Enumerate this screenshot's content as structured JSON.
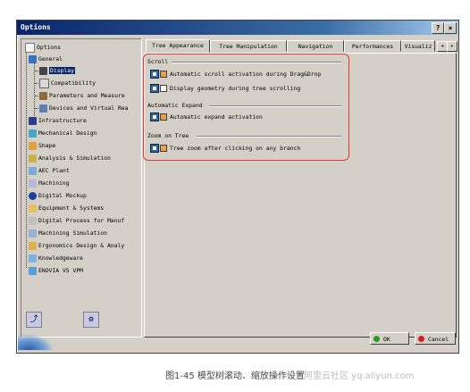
{
  "window": {
    "title": "Options",
    "help_btn": "?",
    "close_btn": "×"
  },
  "tree": {
    "root": "Options",
    "items": [
      {
        "label": "General"
      },
      {
        "label": "Display",
        "selected": true
      },
      {
        "label": "Compatibility"
      },
      {
        "label": "Parameters and Measure"
      },
      {
        "label": "Devices and Virtual Rea"
      },
      {
        "label": "Infrastructure"
      },
      {
        "label": "Mechanical Design"
      },
      {
        "label": "Shape"
      },
      {
        "label": "Analysis & Simulation"
      },
      {
        "label": "AEC Plant"
      },
      {
        "label": "Machining"
      },
      {
        "label": "Digital Mockup"
      },
      {
        "label": "Equipment & Systems"
      },
      {
        "label": "Digital Process for Manuf"
      },
      {
        "label": "Machining Simulation"
      },
      {
        "label": "Ergonomics Design & Analy"
      },
      {
        "label": "Knowledgeware"
      },
      {
        "label": "ENOVIA V5 VPM"
      }
    ]
  },
  "tabs": [
    "Tree Appearance",
    "Tree Manipulation",
    "Navigation",
    "Performances",
    "Visualiz"
  ],
  "groups": {
    "scroll": {
      "title": "Scroll",
      "options": [
        {
          "label": "Automatic scroll activation during Drag&Drop",
          "checked": true
        },
        {
          "label": "Display geometry during tree scrolling",
          "checked": false
        }
      ]
    },
    "expand": {
      "title": "Automatic Expand",
      "options": [
        {
          "label": "Automatic expand activation",
          "checked": true
        }
      ]
    },
    "zoom": {
      "title": "Zoom on Tree",
      "options": [
        {
          "label": "Tree zoom after clicking on any branch",
          "checked": true
        }
      ]
    }
  },
  "buttons": {
    "ok": "OK",
    "cancel": "Cancel"
  },
  "caption": "图1-45 模型树滚动、缩放操作设置",
  "watermark": "阿里云社区 yq.aliyun.com"
}
